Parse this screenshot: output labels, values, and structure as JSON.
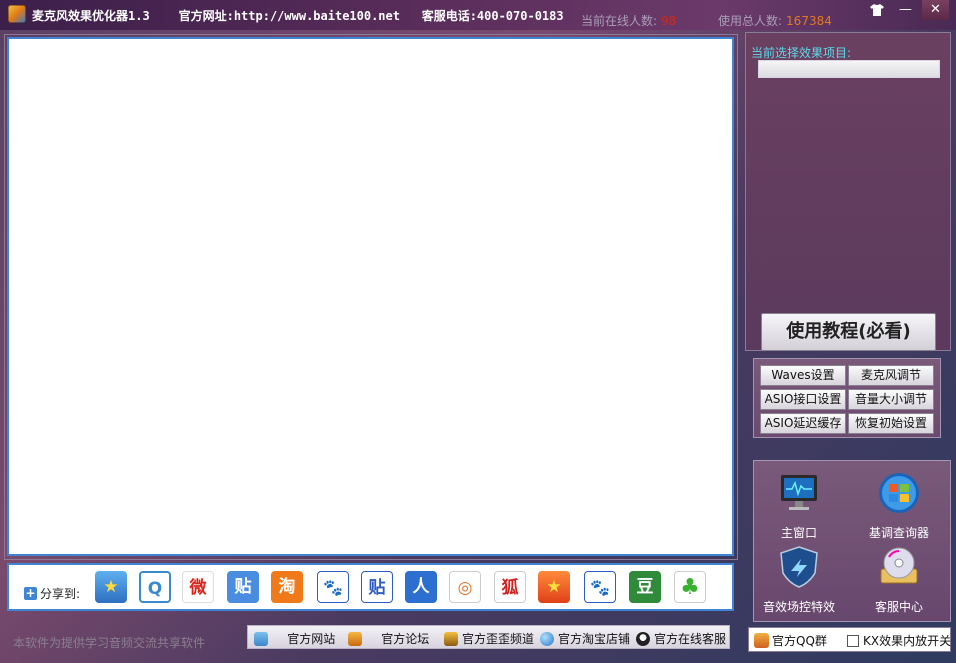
{
  "titlebar": {
    "title": "麦克风效果优化器1.3",
    "website_label": "官方网址:http://www.baite100.net",
    "phone_label": "客服电话:400-070-0183",
    "online_label": "当前在线人数:",
    "online_value": "98",
    "total_label": "使用总人数:",
    "total_value": "167384",
    "skin_icon": "shirt-icon",
    "minimize": "—",
    "close": "✕"
  },
  "share": {
    "label": "分享到:",
    "icons": [
      {
        "name": "qzone-share-icon",
        "glyph": "★"
      },
      {
        "name": "qq-weibo-share-icon",
        "glyph": "Q"
      },
      {
        "name": "sina-weibo-share-icon",
        "glyph": "微"
      },
      {
        "name": "tieba-share-icon",
        "glyph": "贴"
      },
      {
        "name": "taobao-share-icon",
        "glyph": "淘"
      },
      {
        "name": "baidu-share-icon",
        "glyph": "🐾"
      },
      {
        "name": "baidu-tieba-share-icon",
        "glyph": "贴"
      },
      {
        "name": "renren-share-icon",
        "glyph": "人"
      },
      {
        "name": "kaixin-share-icon",
        "glyph": "◎"
      },
      {
        "name": "sohu-share-icon",
        "glyph": "狐"
      },
      {
        "name": "qq-space-star-share-icon",
        "glyph": "★"
      },
      {
        "name": "baidu-space-share-icon",
        "glyph": "🐾"
      },
      {
        "name": "douban-share-icon",
        "glyph": "豆"
      },
      {
        "name": "clover-share-icon",
        "glyph": "♣"
      }
    ]
  },
  "footer": {
    "note": "本软件为提供学习音频交流共享软件",
    "links": [
      "官方网站",
      "官方论坛",
      "官方歪歪频道",
      "官方淘宝店铺",
      "官方在线客服"
    ]
  },
  "right": {
    "selected_label": "当前选择效果项目:",
    "selected_value": "",
    "tutorial": "使用教程(必看)",
    "grid_buttons": [
      "Waves设置",
      "麦克风调节",
      "ASIO接口设置",
      "音量大小调节",
      "ASIO延迟缓存",
      "恢复初始设置"
    ],
    "quad": [
      {
        "label": "主窗口",
        "icon": "monitor-icon"
      },
      {
        "label": "基调查询器",
        "icon": "windows-orb-icon"
      },
      {
        "label": "音效场控特效",
        "icon": "shield-arrow-icon"
      },
      {
        "label": "客服中心",
        "icon": "cd-drive-icon"
      }
    ],
    "qq_group": "官方QQ群",
    "kx_toggle": "KX效果内放开关"
  }
}
